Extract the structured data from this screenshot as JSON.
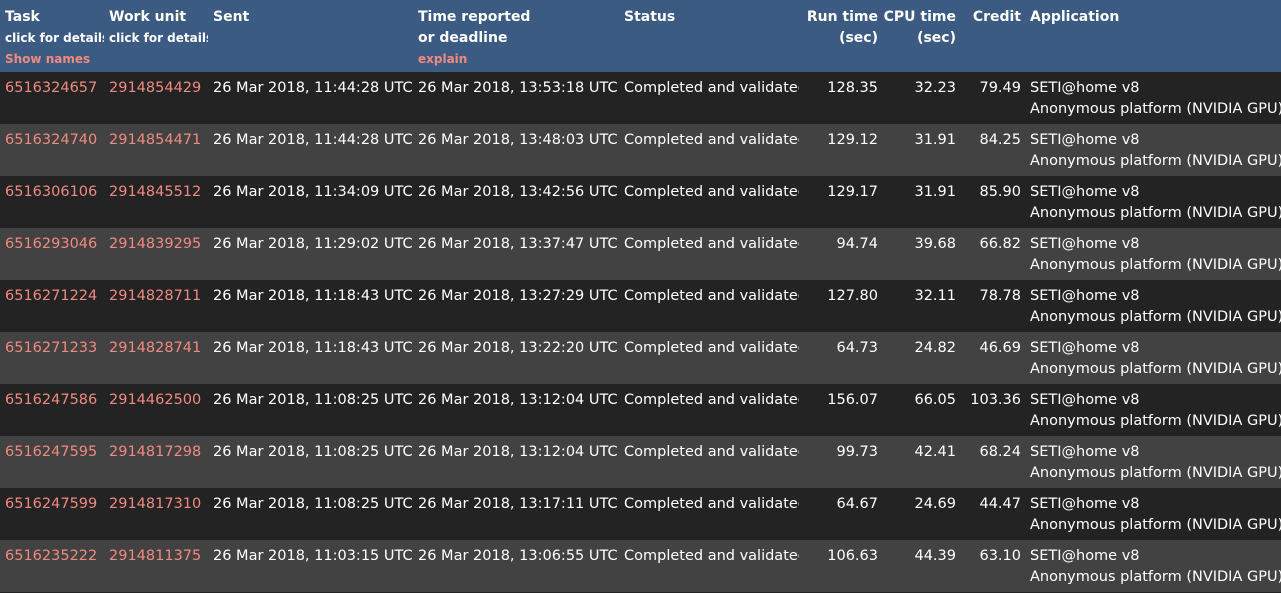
{
  "columns": {
    "task": {
      "label": "Task",
      "sub": "click for details",
      "link": "Show names"
    },
    "workunit": {
      "label": "Work unit",
      "sub": "click for details"
    },
    "sent": {
      "label": "Sent"
    },
    "time_reported": {
      "label": "Time reported",
      "line2": "or deadline",
      "link": "explain"
    },
    "status": {
      "label": "Status"
    },
    "run_time": {
      "label": "Run time",
      "unit": "(sec)"
    },
    "cpu_time": {
      "label": "CPU time",
      "unit": "(sec)"
    },
    "credit": {
      "label": "Credit"
    },
    "application": {
      "label": "Application"
    }
  },
  "rows": [
    {
      "task": "6516324657",
      "workunit": "2914854429",
      "sent": "26 Mar 2018, 11:44:28 UTC",
      "reported": "26 Mar 2018, 13:53:18 UTC",
      "status": "Completed and validated",
      "run_time": "128.35",
      "cpu_time": "32.23",
      "credit": "79.49",
      "app_name": "SETI@home v8",
      "app_platform": "Anonymous platform (NVIDIA GPU)"
    },
    {
      "task": "6516324740",
      "workunit": "2914854471",
      "sent": "26 Mar 2018, 11:44:28 UTC",
      "reported": "26 Mar 2018, 13:48:03 UTC",
      "status": "Completed and validated",
      "run_time": "129.12",
      "cpu_time": "31.91",
      "credit": "84.25",
      "app_name": "SETI@home v8",
      "app_platform": "Anonymous platform (NVIDIA GPU)"
    },
    {
      "task": "6516306106",
      "workunit": "2914845512",
      "sent": "26 Mar 2018, 11:34:09 UTC",
      "reported": "26 Mar 2018, 13:42:56 UTC",
      "status": "Completed and validated",
      "run_time": "129.17",
      "cpu_time": "31.91",
      "credit": "85.90",
      "app_name": "SETI@home v8",
      "app_platform": "Anonymous platform (NVIDIA GPU)"
    },
    {
      "task": "6516293046",
      "workunit": "2914839295",
      "sent": "26 Mar 2018, 11:29:02 UTC",
      "reported": "26 Mar 2018, 13:37:47 UTC",
      "status": "Completed and validated",
      "run_time": "94.74",
      "cpu_time": "39.68",
      "credit": "66.82",
      "app_name": "SETI@home v8",
      "app_platform": "Anonymous platform (NVIDIA GPU)"
    },
    {
      "task": "6516271224",
      "workunit": "2914828711",
      "sent": "26 Mar 2018, 11:18:43 UTC",
      "reported": "26 Mar 2018, 13:27:29 UTC",
      "status": "Completed and validated",
      "run_time": "127.80",
      "cpu_time": "32.11",
      "credit": "78.78",
      "app_name": "SETI@home v8",
      "app_platform": "Anonymous platform (NVIDIA GPU)"
    },
    {
      "task": "6516271233",
      "workunit": "2914828741",
      "sent": "26 Mar 2018, 11:18:43 UTC",
      "reported": "26 Mar 2018, 13:22:20 UTC",
      "status": "Completed and validated",
      "run_time": "64.73",
      "cpu_time": "24.82",
      "credit": "46.69",
      "app_name": "SETI@home v8",
      "app_platform": "Anonymous platform (NVIDIA GPU)"
    },
    {
      "task": "6516247586",
      "workunit": "2914462500",
      "sent": "26 Mar 2018, 11:08:25 UTC",
      "reported": "26 Mar 2018, 13:12:04 UTC",
      "status": "Completed and validated",
      "run_time": "156.07",
      "cpu_time": "66.05",
      "credit": "103.36",
      "app_name": "SETI@home v8",
      "app_platform": "Anonymous platform (NVIDIA GPU)"
    },
    {
      "task": "6516247595",
      "workunit": "2914817298",
      "sent": "26 Mar 2018, 11:08:25 UTC",
      "reported": "26 Mar 2018, 13:12:04 UTC",
      "status": "Completed and validated",
      "run_time": "99.73",
      "cpu_time": "42.41",
      "credit": "68.24",
      "app_name": "SETI@home v8",
      "app_platform": "Anonymous platform (NVIDIA GPU)"
    },
    {
      "task": "6516247599",
      "workunit": "2914817310",
      "sent": "26 Mar 2018, 11:08:25 UTC",
      "reported": "26 Mar 2018, 13:17:11 UTC",
      "status": "Completed and validated",
      "run_time": "64.67",
      "cpu_time": "24.69",
      "credit": "44.47",
      "app_name": "SETI@home v8",
      "app_platform": "Anonymous platform (NVIDIA GPU)"
    },
    {
      "task": "6516235222",
      "workunit": "2914811375",
      "sent": "26 Mar 2018, 11:03:15 UTC",
      "reported": "26 Mar 2018, 13:06:55 UTC",
      "status": "Completed and validated",
      "run_time": "106.63",
      "cpu_time": "44.39",
      "credit": "63.10",
      "app_name": "SETI@home v8",
      "app_platform": "Anonymous platform (NVIDIA GPU)"
    }
  ]
}
